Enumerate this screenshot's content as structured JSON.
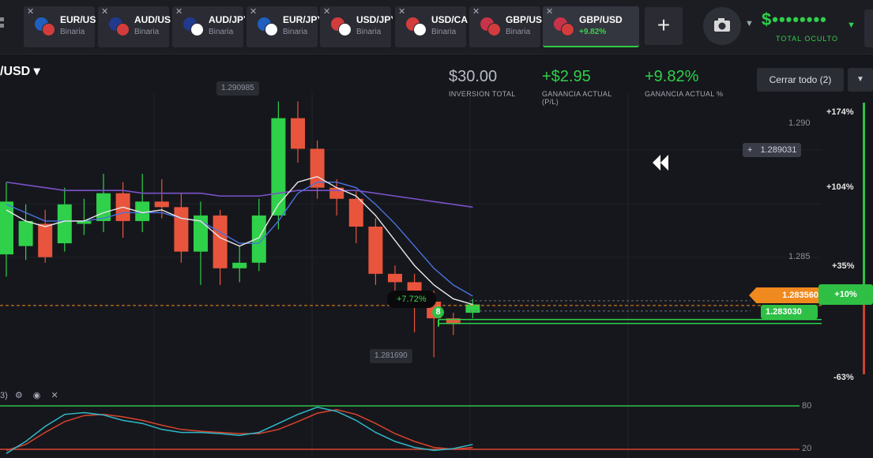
{
  "tabs": [
    {
      "symbol": "EUR/USD",
      "sub": "Binaria",
      "flag1": "#1f5fbf",
      "flag2": "#d33c3c"
    },
    {
      "symbol": "AUD/USD",
      "sub": "Binaria",
      "flag1": "#213a8f",
      "flag2": "#d33c3c"
    },
    {
      "symbol": "AUD/JPY",
      "sub": "Binaria",
      "flag1": "#213a8f",
      "flag2": "#ffffff"
    },
    {
      "symbol": "EUR/JPY",
      "sub": "Binaria",
      "flag1": "#1f5fbf",
      "flag2": "#ffffff"
    },
    {
      "symbol": "USD/JPY",
      "sub": "Binaria",
      "flag1": "#d33c3c",
      "flag2": "#ffffff"
    },
    {
      "symbol": "USD/CAD",
      "sub": "Binaria",
      "flag1": "#d33c3c",
      "flag2": "#ffffff"
    },
    {
      "symbol": "GBP/USD",
      "sub": "Binaria",
      "flag1": "#c8334a",
      "flag2": "#d33c3c"
    },
    {
      "symbol": "GBP/USD",
      "sub": "+9.82%",
      "flag1": "#c8334a",
      "flag2": "#d33c3c",
      "active": true
    }
  ],
  "add_tab": "+",
  "balance": {
    "value": "$••••••••",
    "label": "TOTAL OCULTO"
  },
  "chart_title": "/USD ▾",
  "stats": {
    "investment": {
      "value": "$30.00",
      "label": "INVERSION TOTAL"
    },
    "pnl": {
      "value": "+$2.95",
      "label": "GANANCIA ACTUAL (P/L)"
    },
    "pnl_pct": {
      "value": "+9.82%",
      "label": "GANANCIA ACTUAL %"
    }
  },
  "close_all": "Cerrar todo (2)",
  "scale_pct": [
    "+174%",
    "+104%",
    "+35%",
    "-63%"
  ],
  "price_axis": [
    "1.290",
    "1.285"
  ],
  "crosshair_price": "1.289031",
  "current_price": "1.283560",
  "current_pct": "+10%",
  "entry_price": "1.283030",
  "high_label": "1.290985",
  "low_label": "1.281690",
  "trade_profit": "+7.72%",
  "trade_count": "8",
  "osc_levels": [
    "80",
    "20"
  ],
  "osc_prefix": "3)",
  "colors": {
    "green": "#2fd04a",
    "red": "#e8553c",
    "orange": "#f0891e",
    "bg": "#16171c"
  },
  "chart_data": {
    "type": "candlestick",
    "candles": [
      [
        1.2854,
        1.2873,
        1.288,
        1.2846
      ],
      [
        1.2857,
        1.2866,
        1.2872,
        1.2852
      ],
      [
        1.2865,
        1.2853,
        1.287,
        1.2851
      ],
      [
        1.2858,
        1.2872,
        1.2878,
        1.2855
      ],
      [
        1.2865,
        1.2866,
        1.2874,
        1.2861
      ],
      [
        1.2866,
        1.2876,
        1.2883,
        1.2862
      ],
      [
        1.2876,
        1.2866,
        1.288,
        1.286
      ],
      [
        1.2866,
        1.2873,
        1.2883,
        1.2862
      ],
      [
        1.2873,
        1.2871,
        1.2881,
        1.2867
      ],
      [
        1.2871,
        1.2855,
        1.2876,
        1.2851
      ],
      [
        1.2855,
        1.2868,
        1.2873,
        1.2843
      ],
      [
        1.2868,
        1.2849,
        1.287,
        1.2843
      ],
      [
        1.2849,
        1.2851,
        1.2857,
        1.2844
      ],
      [
        1.2851,
        1.2868,
        1.2874,
        1.2848
      ],
      [
        1.2868,
        1.2903,
        1.2909,
        1.2863
      ],
      [
        1.2903,
        1.2892,
        1.2909,
        1.2887
      ],
      [
        1.2892,
        1.2878,
        1.2895,
        1.2874
      ],
      [
        1.2878,
        1.2874,
        1.2881,
        1.2868
      ],
      [
        1.2874,
        1.2864,
        1.2877,
        1.2858
      ],
      [
        1.2864,
        1.2847,
        1.2867,
        1.2843
      ],
      [
        1.2847,
        1.2844,
        1.285,
        1.2838
      ],
      [
        1.2844,
        1.2837,
        1.2847,
        1.2826
      ],
      [
        1.2837,
        1.2831,
        1.2841,
        1.2817
      ],
      [
        1.2831,
        1.2829,
        1.2833,
        1.2825
      ],
      [
        1.2833,
        1.2836,
        1.2838,
        1.2831
      ]
    ],
    "ma_fast": [
      1.287,
      1.2866,
      1.2864,
      1.2866,
      1.2866,
      1.2869,
      1.2871,
      1.2869,
      1.287,
      1.2867,
      1.2866,
      1.286,
      1.2857,
      1.286,
      1.2872,
      1.288,
      1.2882,
      1.2878,
      1.2875,
      1.2868,
      1.2859,
      1.285,
      1.2843,
      1.2838,
      1.2836
    ],
    "ma_mid": [
      1.2872,
      1.2869,
      1.2866,
      1.2866,
      1.2866,
      1.2867,
      1.2869,
      1.2869,
      1.2869,
      1.2867,
      1.2866,
      1.2862,
      1.2858,
      1.2858,
      1.2866,
      1.2876,
      1.288,
      1.288,
      1.2878,
      1.2872,
      1.2865,
      1.2857,
      1.2849,
      1.2843,
      1.2839
    ],
    "ma_slow": [
      1.288,
      1.2879,
      1.2878,
      1.2877,
      1.2877,
      1.2877,
      1.2877,
      1.2876,
      1.2876,
      1.2876,
      1.2876,
      1.2875,
      1.2875,
      1.2875,
      1.2876,
      1.2877,
      1.2877,
      1.2877,
      1.2877,
      1.2876,
      1.2875,
      1.2874,
      1.2873,
      1.2872,
      1.2871
    ],
    "osc_k": [
      5,
      25,
      50,
      70,
      73,
      69,
      60,
      55,
      45,
      40,
      40,
      38,
      35,
      40,
      55,
      70,
      82,
      75,
      60,
      40,
      25,
      15,
      10,
      13,
      20
    ],
    "osc_d": [
      10,
      20,
      40,
      58,
      68,
      70,
      66,
      60,
      52,
      45,
      42,
      40,
      38,
      38,
      45,
      58,
      72,
      78,
      70,
      55,
      38,
      25,
      15,
      12,
      15
    ],
    "ylim": [
      1.2812,
      1.2912
    ],
    "osc_ylim": [
      0,
      100
    ]
  }
}
